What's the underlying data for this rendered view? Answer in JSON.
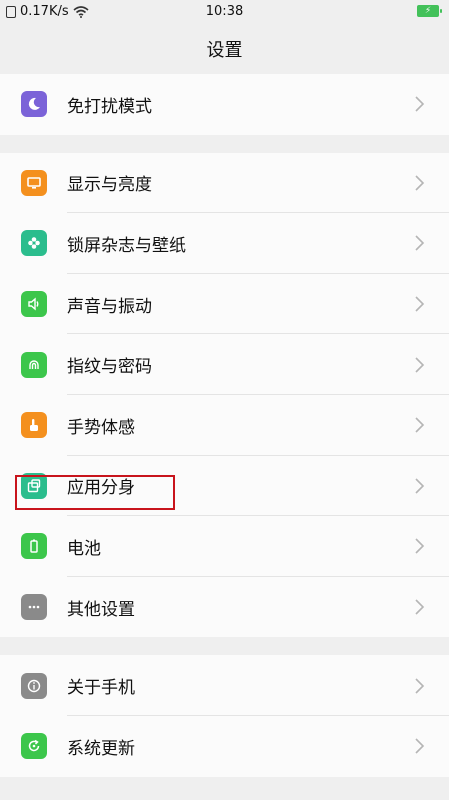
{
  "status": {
    "speed": "0.17K/s",
    "time": "10:38"
  },
  "header": {
    "title": "设置"
  },
  "groups": [
    {
      "items": [
        {
          "label": "免打扰模式",
          "icon": "moon-icon",
          "color": "#7b63d8"
        }
      ]
    },
    {
      "items": [
        {
          "label": "显示与亮度",
          "icon": "display-icon",
          "color": "#f4901e"
        },
        {
          "label": "锁屏杂志与壁纸",
          "icon": "flower-icon",
          "color": "#2bbd8d"
        },
        {
          "label": "声音与振动",
          "icon": "speaker-icon",
          "color": "#3cc64b"
        },
        {
          "label": "指纹与密码",
          "icon": "fingerprint-icon",
          "color": "#3cc64b"
        },
        {
          "label": "手势体感",
          "icon": "hand-icon",
          "color": "#f4901e"
        },
        {
          "label": "应用分身",
          "icon": "app-clone-icon",
          "color": "#2bbd8d"
        },
        {
          "label": "电池",
          "icon": "battery-icon",
          "color": "#3cc64b"
        },
        {
          "label": "其他设置",
          "icon": "more-icon",
          "color": "#8a8a8a"
        }
      ]
    },
    {
      "items": [
        {
          "label": "关于手机",
          "icon": "info-icon",
          "color": "#8a8a8a"
        },
        {
          "label": "系统更新",
          "icon": "update-icon",
          "color": "#3cc64b"
        }
      ]
    }
  ]
}
